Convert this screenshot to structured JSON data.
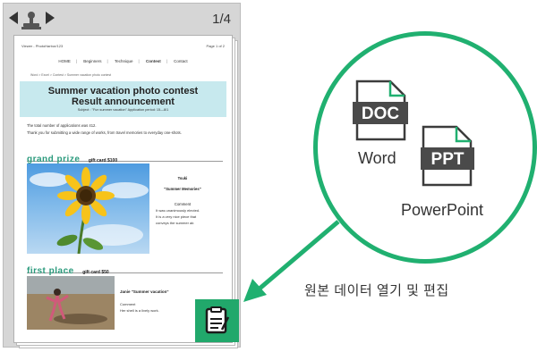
{
  "viewer": {
    "page_counter": "1/4",
    "document": {
      "url": "Viewer - PhotoHarbor/123",
      "page_label": "Page 1 of 2",
      "nav": [
        "HOME",
        "Beginners",
        "Technique",
        "Contest",
        "Contact"
      ],
      "nav_active": "Contest",
      "breadcrumb": "Word > Excel > Contest > Summer vacation photo contest",
      "banner_title_1": "Summer vacation photo contest",
      "banner_title_2": "Result announcement",
      "banner_subtitle": "Subject : \"Fun summer vacation\"  Application period: 15—8/1",
      "intro_1": "The total number of applications was 412.",
      "intro_2": "Thank you for submitting a wide range of works, from travel memories to everyday one-shots.",
      "grand_prize": {
        "heading": "grand prize",
        "gift": "gift card $100",
        "name": "Tsuki",
        "title": "\"Summer Memories\"",
        "comment_label": "Comment",
        "comment": [
          "It was unanimously elected.",
          "It is a very nice piece that",
          "conveys the summer air."
        ]
      },
      "first_place": {
        "heading": "first place",
        "gift": "gift card $50",
        "title": "Janie   \"Summer vacation\"",
        "comment_label": "Comment",
        "comment": "Her shell is a lively work."
      }
    }
  },
  "callout": {
    "doc_badge": "DOC",
    "doc_label": "Word",
    "ppt_badge": "PPT",
    "ppt_label": "PowerPoint",
    "caption": "원본 데이터 열기 및 편집"
  },
  "colors": {
    "accent_green": "#20b070",
    "edit_button": "#21a86b",
    "banner": "#c7e9ee",
    "icon_dark": "#4a4a4a"
  },
  "icons": {
    "prev": "triangle-left-icon",
    "next": "triangle-right-icon",
    "stamp": "stamp-icon",
    "edit": "document-edit-icon",
    "doc": "doc-file-icon",
    "ppt": "ppt-file-icon"
  }
}
